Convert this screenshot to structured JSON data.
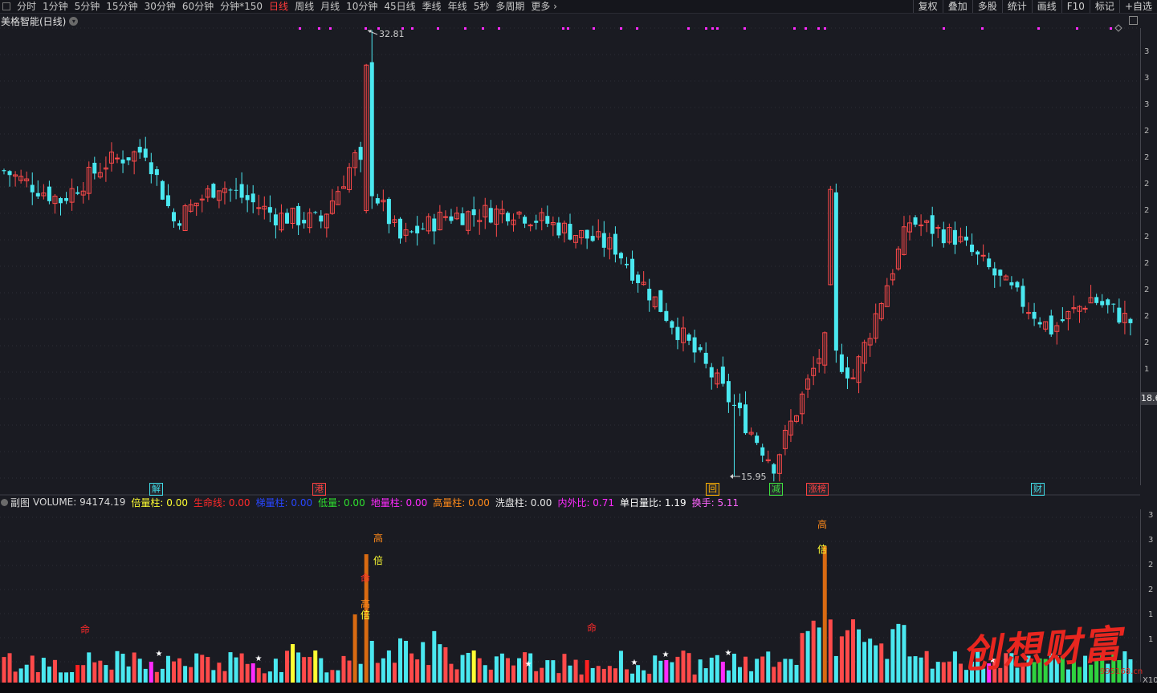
{
  "toolbar": {
    "tabs": [
      {
        "label": "分时"
      },
      {
        "label": "1分钟"
      },
      {
        "label": "5分钟"
      },
      {
        "label": "15分钟"
      },
      {
        "label": "30分钟"
      },
      {
        "label": "60分钟"
      },
      {
        "label": "分钟*150"
      },
      {
        "label": "日线",
        "active": true
      },
      {
        "label": "周线"
      },
      {
        "label": "月线"
      },
      {
        "label": "10分钟"
      },
      {
        "label": "45日线"
      },
      {
        "label": "季线"
      },
      {
        "label": "年线"
      },
      {
        "label": "5秒"
      },
      {
        "label": "多周期"
      },
      {
        "label": "更多"
      }
    ],
    "tools": [
      {
        "label": "复权"
      },
      {
        "label": "叠加"
      },
      {
        "label": "多股"
      },
      {
        "label": "统计"
      },
      {
        "label": "画线"
      },
      {
        "label": "F10"
      },
      {
        "label": "标记"
      },
      {
        "label": "+自选"
      }
    ]
  },
  "stock": {
    "title": "美格智能(日线)"
  },
  "main_chart": {
    "high_label": "32.81",
    "low_label": "15.95",
    "current_price": "18.6",
    "axis_ticks": [
      {
        "label": "3"
      },
      {
        "label": "3"
      },
      {
        "label": "3"
      },
      {
        "label": "2"
      },
      {
        "label": "2"
      },
      {
        "label": "2"
      },
      {
        "label": "2"
      },
      {
        "label": "2"
      },
      {
        "label": "2"
      },
      {
        "label": "2"
      },
      {
        "label": "2"
      },
      {
        "label": "2"
      },
      {
        "label": "1"
      },
      {
        "label": "1"
      }
    ],
    "events": [
      {
        "label": "解",
        "color": "#3fdbe6"
      },
      {
        "label": "港",
        "color": "#ff4040"
      },
      {
        "label": "回",
        "color": "#ffb000"
      },
      {
        "label": "减",
        "color": "#3fe03f"
      },
      {
        "label": "涨榜",
        "color": "#ff4040"
      },
      {
        "label": "财",
        "color": "#3fdbe6"
      }
    ]
  },
  "sub_chart": {
    "name": "副图",
    "legend": [
      {
        "label": "VOLUME: 94174.19",
        "color": "#d8d8d8"
      },
      {
        "label": "倍量柱: 0.00",
        "color": "#ffff33"
      },
      {
        "label": "生命线: 0.00",
        "color": "#ff2a2a"
      },
      {
        "label": "梯量柱: 0.00",
        "color": "#2846ff"
      },
      {
        "label": "低量: 0.00",
        "color": "#2fe02f"
      },
      {
        "label": "地量柱: 0.00",
        "color": "#ff2bff"
      },
      {
        "label": "高量柱: 0.00",
        "color": "#ff8a1a"
      },
      {
        "label": "洗盘柱: 0.00",
        "color": "#e6e6e6"
      },
      {
        "label": "内外比: 0.71",
        "color": "#ff2bff"
      },
      {
        "label": "单日量比: 1.19",
        "color": "#ffffff"
      },
      {
        "label": "换手: 5.11",
        "color": "#ff66ff"
      }
    ],
    "axis_ticks": [
      {
        "label": "3"
      },
      {
        "label": "3"
      },
      {
        "label": "2"
      },
      {
        "label": "2"
      },
      {
        "label": "1"
      },
      {
        "label": "1"
      }
    ],
    "multiplier": "X10",
    "markers": [
      {
        "label": "高",
        "color": "#ff8a1a"
      },
      {
        "label": "倍",
        "color": "#ffff33"
      },
      {
        "label": "命",
        "color": "#ff2a2a"
      },
      {
        "label": "高",
        "color": "#ff8a1a"
      },
      {
        "label": "倍",
        "color": "#ffff33"
      },
      {
        "label": "命",
        "color": "#ff2a2a"
      },
      {
        "label": "高",
        "color": "#ff8a1a"
      },
      {
        "label": "倍",
        "color": "#ffff33"
      },
      {
        "label": "命",
        "color": "#ff2a2a"
      }
    ]
  },
  "watermark": {
    "text": "创想财富",
    "url": "995168.cn"
  },
  "colors": {
    "up": "#ff4a4a",
    "down": "#4ae8f0",
    "bg": "#1a1b22"
  }
}
